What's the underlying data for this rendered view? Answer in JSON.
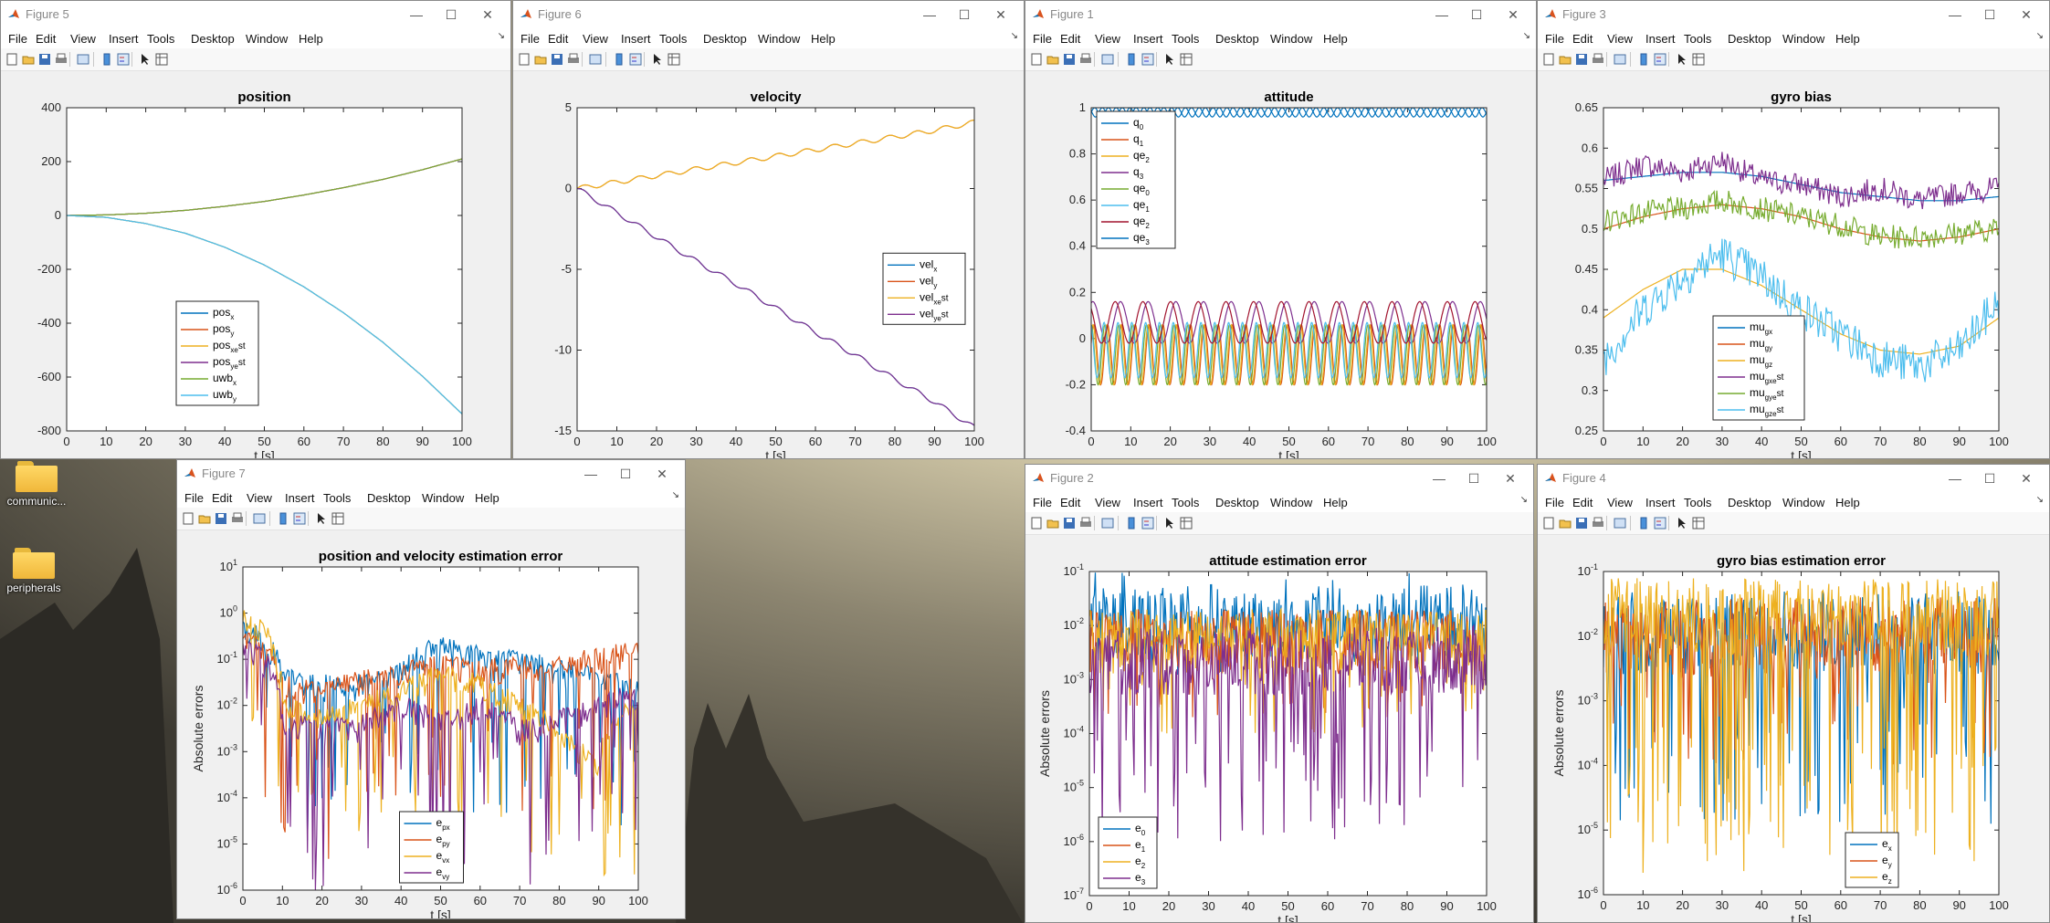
{
  "desktop": {
    "icons": [
      {
        "label": "communic..."
      },
      {
        "label": "peripherals"
      }
    ]
  },
  "menu": [
    "File",
    "Edit",
    "View",
    "Insert",
    "Tools",
    "Desktop",
    "Window",
    "Help"
  ],
  "figures": [
    {
      "window_title": "Figure 5",
      "chart_title": "position"
    },
    {
      "window_title": "Figure 6",
      "chart_title": "velocity"
    },
    {
      "window_title": "Figure 1",
      "chart_title": "attitude"
    },
    {
      "window_title": "Figure 3",
      "chart_title": "gyro bias"
    },
    {
      "window_title": "Figure 7",
      "chart_title": "position and velocity estimation error"
    },
    {
      "window_title": "Figure 2",
      "chart_title": "attitude estimation error"
    },
    {
      "window_title": "Figure 4",
      "chart_title": "gyro bias estimation error"
    }
  ],
  "chart_data": [
    {
      "figure": "Figure 5",
      "type": "line",
      "title": "position",
      "xlabel": "t [s]",
      "ylabel": "",
      "xlim": [
        0,
        100
      ],
      "ylim": [
        -800,
        400
      ],
      "xticks": [
        0,
        10,
        20,
        30,
        40,
        50,
        60,
        70,
        80,
        90,
        100
      ],
      "yticks": [
        -800,
        -600,
        -400,
        -200,
        0,
        200,
        400
      ],
      "legend_position": "bottom-center",
      "series": [
        {
          "name": "pos_x",
          "color": "#0072BD",
          "x": [
            0,
            10,
            20,
            30,
            40,
            50,
            60,
            70,
            80,
            90,
            100
          ],
          "y": [
            0,
            -7,
            -30,
            -66,
            -118,
            -184,
            -265,
            -361,
            -471,
            -597,
            -737
          ]
        },
        {
          "name": "pos_y",
          "color": "#D95319",
          "x": [
            0,
            10,
            20,
            30,
            40,
            50,
            60,
            70,
            80,
            90,
            100
          ],
          "y": [
            0,
            2,
            8,
            19,
            34,
            52,
            76,
            103,
            134,
            170,
            210
          ]
        },
        {
          "name": "pos_xe^st",
          "color": "#EDB120",
          "x": [
            0,
            10,
            20,
            30,
            40,
            50,
            60,
            70,
            80,
            90,
            100
          ],
          "y": [
            0,
            -7,
            -30,
            -66,
            -118,
            -184,
            -265,
            -361,
            -471,
            -597,
            -737
          ]
        },
        {
          "name": "pos_ye^st",
          "color": "#7E2F8E",
          "x": [
            0,
            10,
            20,
            30,
            40,
            50,
            60,
            70,
            80,
            90,
            100
          ],
          "y": [
            0,
            2,
            8,
            19,
            34,
            52,
            76,
            103,
            134,
            170,
            210
          ]
        },
        {
          "name": "uwb_x",
          "color": "#77AC30",
          "x": [
            0,
            10,
            20,
            30,
            40,
            50,
            60,
            70,
            80,
            90,
            100
          ],
          "y": [
            0,
            2,
            8,
            19,
            34,
            52,
            76,
            103,
            134,
            170,
            210
          ]
        },
        {
          "name": "uwb_y",
          "color": "#4DBEEE",
          "x": [
            0,
            10,
            20,
            30,
            40,
            50,
            60,
            70,
            80,
            90,
            100
          ],
          "y": [
            0,
            -7,
            -30,
            -66,
            -118,
            -184,
            -265,
            -361,
            -471,
            -597,
            -737
          ]
        }
      ]
    },
    {
      "figure": "Figure 6",
      "type": "line",
      "title": "velocity",
      "xlabel": "t [s]",
      "ylabel": "",
      "xlim": [
        0,
        100
      ],
      "ylim": [
        -15,
        5
      ],
      "xticks": [
        0,
        10,
        20,
        30,
        40,
        50,
        60,
        70,
        80,
        90,
        100
      ],
      "yticks": [
        -15,
        -10,
        -5,
        0,
        5
      ],
      "legend_position": "middle-right",
      "series": [
        {
          "name": "vel_x",
          "color": "#0072BD",
          "x": [
            0,
            10,
            20,
            30,
            40,
            50,
            60,
            70,
            80,
            90,
            100
          ],
          "y": [
            0,
            -1.5,
            -3.0,
            -4.5,
            -5.9,
            -7.4,
            -8.9,
            -10.3,
            -11.8,
            -13.2,
            -14.8
          ]
        },
        {
          "name": "vel_y",
          "color": "#D95319",
          "x": [
            0,
            10,
            20,
            30,
            40,
            50,
            60,
            70,
            80,
            90,
            100
          ],
          "y": [
            0,
            0.4,
            0.8,
            1.2,
            1.6,
            2.0,
            2.4,
            2.8,
            3.2,
            3.6,
            4.1
          ]
        },
        {
          "name": "vel_xe^st",
          "color": "#EDB120",
          "x": [
            0,
            10,
            20,
            30,
            40,
            50,
            60,
            70,
            80,
            90,
            100
          ],
          "y": [
            0,
            0.4,
            0.8,
            1.2,
            1.6,
            2.0,
            2.4,
            2.8,
            3.2,
            3.6,
            4.1
          ]
        },
        {
          "name": "vel_ye^st",
          "color": "#7E2F8E",
          "x": [
            0,
            10,
            20,
            30,
            40,
            50,
            60,
            70,
            80,
            90,
            100
          ],
          "y": [
            0,
            -1.5,
            -3.0,
            -4.5,
            -5.9,
            -7.4,
            -8.9,
            -10.3,
            -11.8,
            -13.2,
            -14.8
          ]
        }
      ]
    },
    {
      "figure": "Figure 1",
      "type": "line",
      "title": "attitude",
      "xlabel": "t [s]",
      "ylabel": "",
      "xlim": [
        0,
        100
      ],
      "ylim": [
        -0.4,
        1
      ],
      "xticks": [
        0,
        10,
        20,
        30,
        40,
        50,
        60,
        70,
        80,
        90,
        100
      ],
      "yticks": [
        -0.4,
        -0.2,
        0,
        0.2,
        0.4,
        0.6,
        0.8,
        1
      ],
      "legend_position": "top-left",
      "series": [
        {
          "name": "q_0",
          "color": "#0072BD",
          "mean": 0.98,
          "amplitude": 0.02,
          "period": 3.5
        },
        {
          "name": "q_1",
          "color": "#D95319",
          "mean": -0.07,
          "amplitude": 0.13,
          "period": 3.5
        },
        {
          "name": "qe_2",
          "color": "#EDB120",
          "mean": -0.07,
          "amplitude": 0.13,
          "period": 3.5
        },
        {
          "name": "q_3",
          "color": "#7E2F8E",
          "mean": 0.07,
          "amplitude": 0.09,
          "period": 7.0
        },
        {
          "name": "qe_0",
          "color": "#77AC30",
          "mean": -0.07,
          "amplitude": 0.13,
          "period": 3.5
        },
        {
          "name": "qe_1",
          "color": "#4DBEEE",
          "mean": -0.05,
          "amplitude": 0.12,
          "period": 3.5
        },
        {
          "name": "qe_2",
          "color": "#A2142F",
          "mean": 0.07,
          "amplitude": 0.09,
          "period": 7.0
        },
        {
          "name": "qe_3",
          "color": "#0072BD",
          "mean": 0.98,
          "amplitude": 0.02,
          "period": 3.5
        }
      ]
    },
    {
      "figure": "Figure 3",
      "type": "line",
      "title": "gyro bias",
      "xlabel": "t [s]",
      "ylabel": "",
      "xlim": [
        0,
        100
      ],
      "ylim": [
        0.25,
        0.65
      ],
      "xticks": [
        0,
        10,
        20,
        30,
        40,
        50,
        60,
        70,
        80,
        90,
        100
      ],
      "yticks": [
        0.25,
        0.3,
        0.35,
        0.4,
        0.45,
        0.5,
        0.55,
        0.6,
        0.65
      ],
      "legend_position": "bottom-center",
      "series": [
        {
          "name": "mu_gx",
          "color": "#0072BD",
          "x": [
            0,
            10,
            20,
            30,
            40,
            50,
            60,
            70,
            80,
            90,
            100
          ],
          "y": [
            0.56,
            0.565,
            0.57,
            0.57,
            0.565,
            0.555,
            0.545,
            0.54,
            0.535,
            0.535,
            0.54
          ]
        },
        {
          "name": "mu_gy",
          "color": "#D95319",
          "x": [
            0,
            10,
            20,
            30,
            40,
            50,
            60,
            70,
            80,
            90,
            100
          ],
          "y": [
            0.5,
            0.515,
            0.525,
            0.53,
            0.525,
            0.515,
            0.5,
            0.49,
            0.485,
            0.49,
            0.5
          ]
        },
        {
          "name": "mu_gz",
          "color": "#EDB120",
          "x": [
            0,
            10,
            20,
            30,
            40,
            50,
            60,
            70,
            80,
            90,
            100
          ],
          "y": [
            0.39,
            0.425,
            0.45,
            0.45,
            0.43,
            0.4,
            0.37,
            0.35,
            0.345,
            0.355,
            0.39
          ]
        },
        {
          "name": "mu_gxe^st",
          "color": "#7E2F8E",
          "x": [
            0,
            10,
            20,
            30,
            40,
            50,
            60,
            70,
            80,
            90,
            100
          ],
          "y": [
            0.56,
            0.58,
            0.57,
            0.585,
            0.56,
            0.555,
            0.54,
            0.55,
            0.535,
            0.545,
            0.55
          ]
        },
        {
          "name": "mu_gye^st",
          "color": "#77AC30",
          "x": [
            0,
            10,
            20,
            30,
            40,
            50,
            60,
            70,
            80,
            90,
            100
          ],
          "y": [
            0.51,
            0.52,
            0.525,
            0.535,
            0.525,
            0.515,
            0.505,
            0.49,
            0.49,
            0.495,
            0.5
          ]
        },
        {
          "name": "mu_gze^st",
          "color": "#4DBEEE",
          "x": [
            0,
            10,
            20,
            30,
            40,
            50,
            60,
            70,
            80,
            90,
            100
          ],
          "y": [
            0.34,
            0.4,
            0.44,
            0.47,
            0.44,
            0.4,
            0.37,
            0.34,
            0.33,
            0.35,
            0.41
          ]
        }
      ]
    },
    {
      "figure": "Figure 7",
      "type": "line",
      "title": "position and velocity estimation error",
      "xlabel": "t [s]",
      "ylabel": "Absolute errors",
      "yscale": "log",
      "xlim": [
        0,
        100
      ],
      "ylim": [
        1e-06,
        10
      ],
      "xticks": [
        0,
        10,
        20,
        30,
        40,
        50,
        60,
        70,
        80,
        90,
        100
      ],
      "yticks": [
        "10^-6",
        "10^-5",
        "10^-4",
        "10^-3",
        "10^-2",
        "10^-1",
        "10^0",
        "10^1"
      ],
      "legend_position": "bottom-center",
      "series": [
        {
          "name": "e_px",
          "color": "#0072BD",
          "x": [
            0,
            10,
            20,
            30,
            40,
            50,
            60,
            70,
            80,
            90,
            100
          ],
          "y": [
            0.5,
            0.04,
            0.03,
            0.03,
            0.06,
            0.2,
            0.12,
            0.1,
            0.06,
            0.04,
            0.02
          ]
        },
        {
          "name": "e_py",
          "color": "#D95319",
          "x": [
            0,
            10,
            20,
            30,
            40,
            50,
            60,
            70,
            80,
            90,
            100
          ],
          "y": [
            0.3,
            0.03,
            0.02,
            0.04,
            0.05,
            0.09,
            0.06,
            0.08,
            0.07,
            0.12,
            0.15
          ]
        },
        {
          "name": "e_vx",
          "color": "#EDB120",
          "x": [
            0,
            10,
            20,
            30,
            40,
            50,
            60,
            70,
            80,
            90,
            100
          ],
          "y": [
            0.8,
            0.01,
            0.005,
            0.01,
            0.02,
            0.05,
            0.03,
            0.01,
            0.002,
            0.0003,
            0.01
          ]
        },
        {
          "name": "e_vy",
          "color": "#7E2F8E",
          "x": [
            0,
            10,
            20,
            30,
            40,
            50,
            60,
            70,
            80,
            90,
            100
          ],
          "y": [
            0.2,
            0.005,
            0.003,
            0.004,
            0.01,
            0.004,
            0.01,
            0.003,
            0.005,
            0.01,
            0.02
          ]
        }
      ]
    },
    {
      "figure": "Figure 2",
      "type": "line",
      "title": "attitude estimation error",
      "xlabel": "t [s]",
      "ylabel": "Absolute errors",
      "yscale": "log",
      "xlim": [
        0,
        100
      ],
      "ylim": [
        1e-07,
        0.1
      ],
      "xticks": [
        0,
        10,
        20,
        30,
        40,
        50,
        60,
        70,
        80,
        90,
        100
      ],
      "yticks": [
        "10^-7",
        "10^-6",
        "10^-5",
        "10^-4",
        "10^-3",
        "10^-2",
        "10^-1"
      ],
      "legend_position": "bottom-left",
      "series": [
        {
          "name": "e_0",
          "color": "#0072BD",
          "typical": 0.01,
          "low": 0.001,
          "high": 0.06
        },
        {
          "name": "e_1",
          "color": "#D95319",
          "typical": 0.005,
          "low": 0.0002,
          "high": 0.02
        },
        {
          "name": "e_2",
          "color": "#EDB120",
          "typical": 0.005,
          "low": 0.0001,
          "high": 0.02
        },
        {
          "name": "e_3",
          "color": "#7E2F8E",
          "typical": 0.002,
          "low": 1e-06,
          "high": 0.01
        }
      ]
    },
    {
      "figure": "Figure 4",
      "type": "line",
      "title": "gyro bias estimation error",
      "xlabel": "t [s]",
      "ylabel": "Absolute errors",
      "yscale": "log",
      "xlim": [
        0,
        100
      ],
      "ylim": [
        1e-06,
        0.1
      ],
      "xticks": [
        0,
        10,
        20,
        30,
        40,
        50,
        60,
        70,
        80,
        90,
        100
      ],
      "yticks": [
        "10^-6",
        "10^-5",
        "10^-4",
        "10^-3",
        "10^-2",
        "10^-1"
      ],
      "legend_position": "bottom-right",
      "series": [
        {
          "name": "e_x",
          "color": "#0072BD",
          "typical": 0.01,
          "low": 1e-05,
          "high": 0.05
        },
        {
          "name": "e_y",
          "color": "#D95319",
          "typical": 0.01,
          "low": 0.0001,
          "high": 0.03
        },
        {
          "name": "e_z",
          "color": "#EDB120",
          "typical": 0.02,
          "low": 2e-06,
          "high": 0.07
        }
      ]
    }
  ]
}
